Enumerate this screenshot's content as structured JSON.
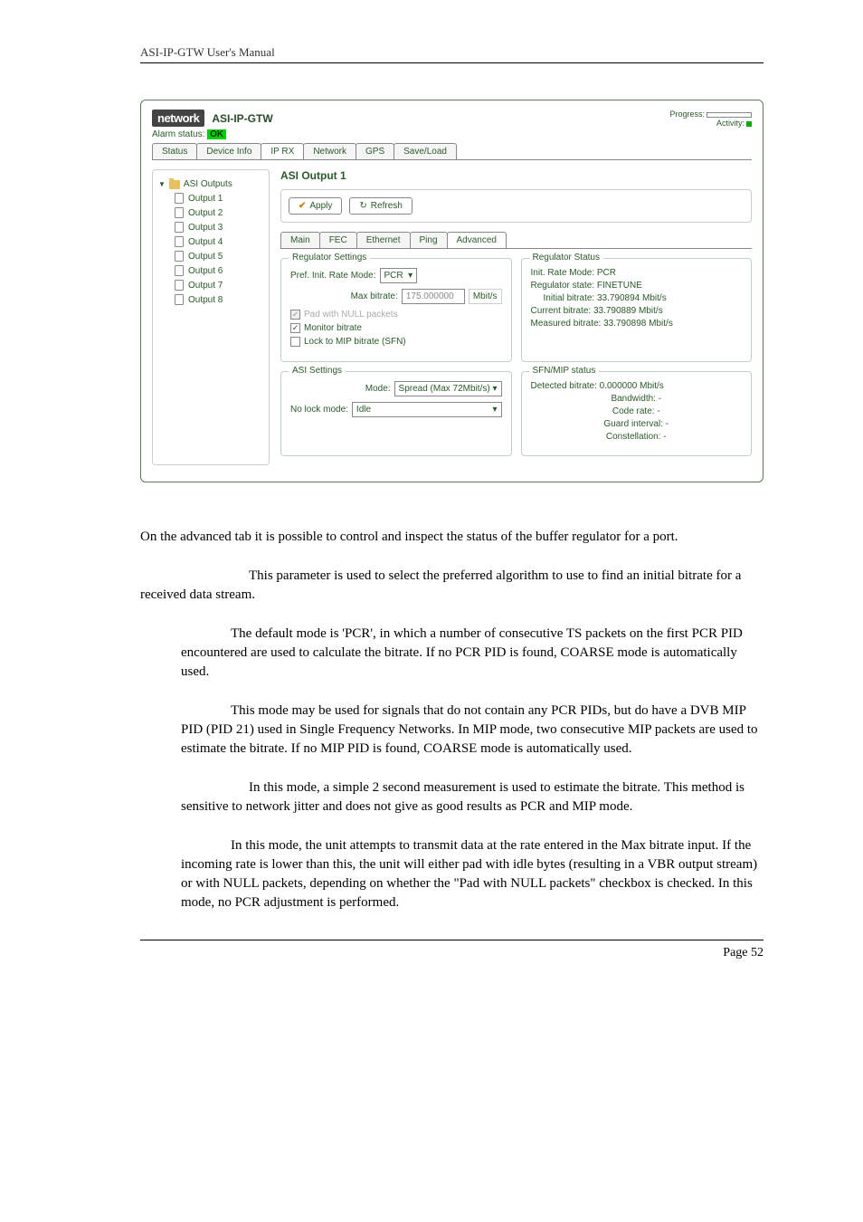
{
  "header": "ASI-IP-GTW User's Manual",
  "ss": {
    "logo": "network",
    "model": "ASI-IP-GTW",
    "progress_label": "Progress:",
    "activity_label": "Activity:",
    "alarm_label": "Alarm status:",
    "alarm_value": "OK",
    "top_tabs": [
      "Status",
      "Device Info",
      "IP RX",
      "Network",
      "GPS",
      "Save/Load"
    ],
    "active_top_tab": 2,
    "tree_root": "ASI Outputs",
    "outputs": [
      "Output 1",
      "Output 2",
      "Output 3",
      "Output 4",
      "Output 5",
      "Output 6",
      "Output 7",
      "Output 8"
    ],
    "panel_title": "ASI Output 1",
    "apply_btn": "Apply",
    "refresh_btn": "Refresh",
    "inner_tabs": [
      "Main",
      "FEC",
      "Ethernet",
      "Ping",
      "Advanced"
    ],
    "active_inner_tab": 4,
    "regulator_settings": {
      "legend": "Regulator Settings",
      "rate_mode_label": "Pref. Init. Rate Mode:",
      "rate_mode_value": "PCR",
      "max_bitrate_label": "Max bitrate:",
      "max_bitrate_value": "175.000000",
      "max_bitrate_unit": "Mbit/s",
      "pad_null": "Pad with NULL packets",
      "monitor": "Monitor bitrate",
      "lock_mip": "Lock to MIP bitrate (SFN)"
    },
    "regulator_status": {
      "legend": "Regulator Status",
      "l1": "Init. Rate Mode: PCR",
      "l2": "Regulator state: FINETUNE",
      "l3": "Initial bitrate: 33.790894 Mbit/s",
      "l4": "Current bitrate: 33.790889 Mbit/s",
      "l5": "Measured bitrate: 33.790898 Mbit/s"
    },
    "asi_settings": {
      "legend": "ASI Settings",
      "mode_label": "Mode:",
      "mode_value": "Spread (Max 72Mbit/s)",
      "nolock_label": "No lock mode:",
      "nolock_value": "Idle"
    },
    "sfn_status": {
      "legend": "SFN/MIP status",
      "l1": "Detected bitrate: 0.000000 Mbit/s",
      "l2": "Bandwidth: -",
      "l3": "Code rate: -",
      "l4": "Guard interval: -",
      "l5": "Constellation: -"
    }
  },
  "para1": "On the advanced tab it is possible to control and inspect the status of the buffer regulator for a port.",
  "para2": "This parameter is used to select the preferred algorithm to use to find an initial bitrate for a received data stream.",
  "para3": "The default mode is 'PCR', in which a number of consecutive TS packets on the first PCR PID encountered are used to calculate the bitrate. If no PCR PID is found, COARSE mode is automatically used.",
  "para4": "This mode may be used for signals that do not contain any PCR PIDs, but do have a DVB MIP PID (PID 21) used in Single Frequency Networks. In MIP mode, two consecutive MIP packets are used to estimate the bitrate. If no MIP PID is found, COARSE mode is automatically used.",
  "para5": "In this mode, a simple 2 second measurement is used to estimate the bitrate. This method is sensitive to network jitter and does not give as good results as PCR and MIP mode.",
  "para6": "In this mode, the unit attempts to transmit data at the rate entered in the Max bitrate input. If the incoming rate is lower than this, the unit will either pad with idle bytes (resulting in a VBR output stream) or with NULL packets, depending on whether the \"Pad with NULL packets\" checkbox is checked. In this mode, no PCR adjustment is performed.",
  "footer": "Page 52"
}
